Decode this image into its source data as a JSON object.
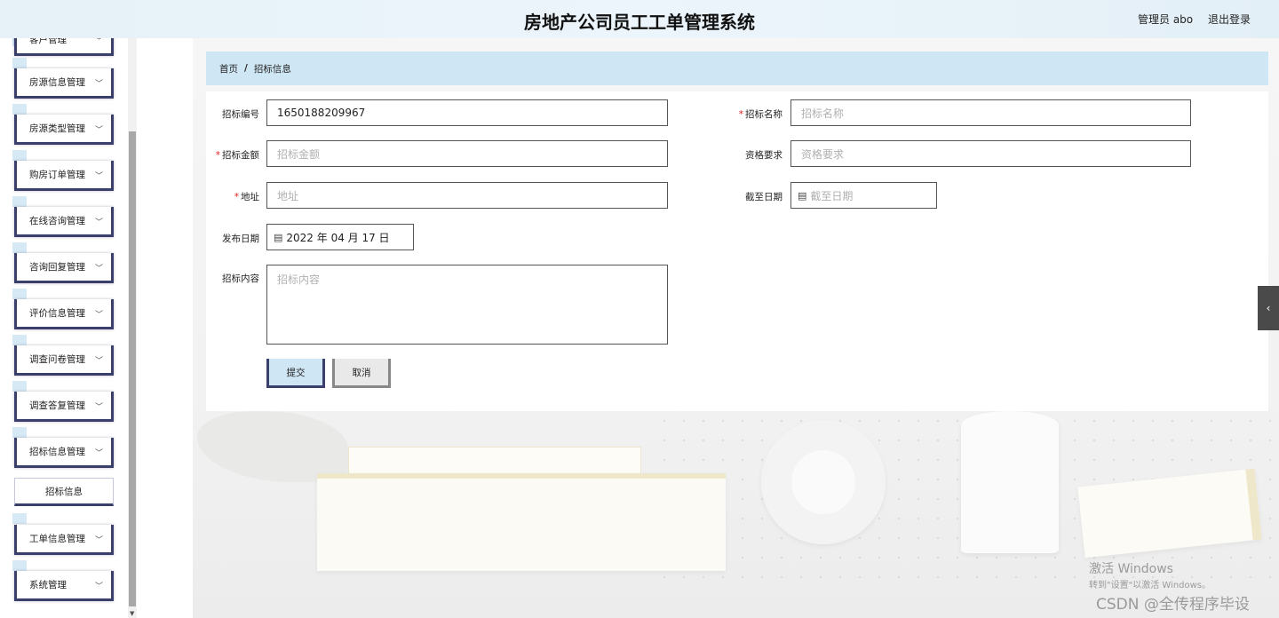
{
  "header": {
    "title": "房地产公司员工工单管理系统",
    "user": "管理员 abo",
    "logout": "退出登录"
  },
  "sidebar": {
    "items": [
      {
        "label": "客户管理"
      },
      {
        "label": "房源信息管理"
      },
      {
        "label": "房源类型管理"
      },
      {
        "label": "购房订单管理"
      },
      {
        "label": "在线咨询管理"
      },
      {
        "label": "咨询回复管理"
      },
      {
        "label": "评价信息管理"
      },
      {
        "label": "调查问卷管理"
      },
      {
        "label": "调查答复管理"
      },
      {
        "label": "招标信息管理"
      },
      {
        "label": "工单信息管理"
      },
      {
        "label": "系统管理"
      }
    ],
    "sub_item": "招标信息",
    "chevron": "chevron-down-icon"
  },
  "breadcrumb": {
    "home": "首页",
    "separator": "/",
    "current": "招标信息"
  },
  "form": {
    "bid_no": {
      "label": "招标编号",
      "value": "1650188209967"
    },
    "bid_name": {
      "label": "招标名称",
      "placeholder": "招标名称",
      "required": "*"
    },
    "bid_amount": {
      "label": "招标金额",
      "placeholder": "招标金额",
      "required": "*"
    },
    "qualification": {
      "label": "资格要求",
      "placeholder": "资格要求"
    },
    "address": {
      "label": "地址",
      "placeholder": "地址",
      "required": "*"
    },
    "deadline": {
      "label": "截至日期",
      "placeholder": "截至日期"
    },
    "publish_date": {
      "label": "发布日期",
      "value": "2022 年 04 月 17 日"
    },
    "content": {
      "label": "招标内容",
      "placeholder": "招标内容"
    },
    "submit": "提交",
    "cancel": "取消"
  },
  "watermark": {
    "line1": "激活 Windows",
    "line2": "转到\"设置\"以激活 Windows。",
    "line3": "CSDN @全传程序毕设"
  },
  "colors": {
    "accent": "#cfe6f4",
    "menu_border": "#3a3f6b",
    "required": "#e02020"
  }
}
